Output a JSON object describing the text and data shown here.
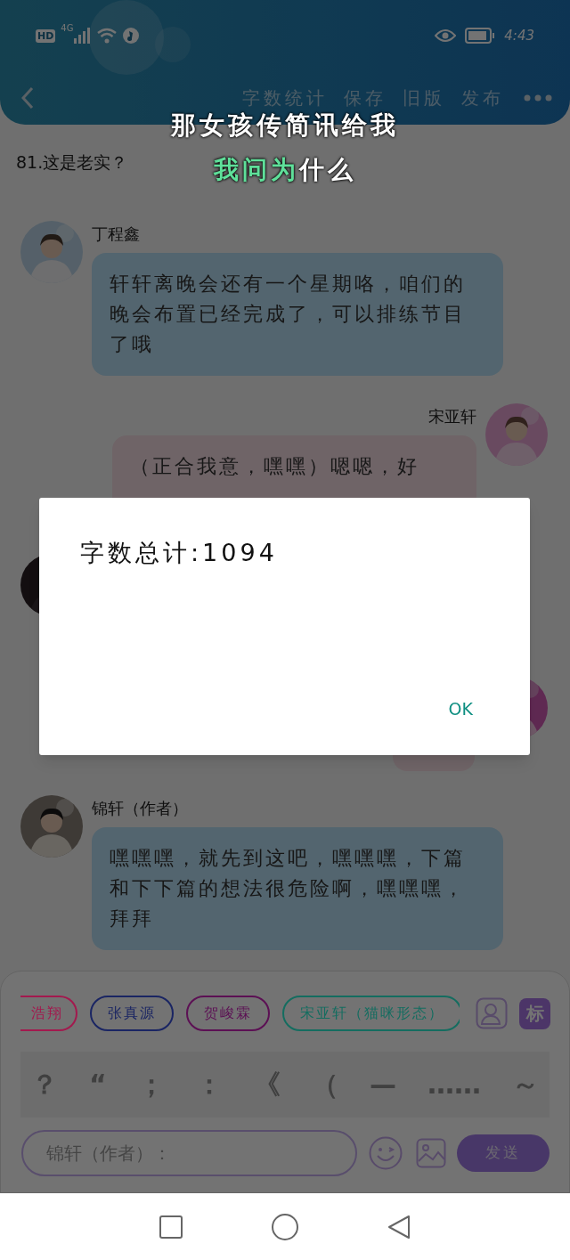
{
  "status_bar": {
    "network_labels": [
      "HD",
      "4G"
    ],
    "time": "4:43"
  },
  "toolbar": {
    "actions": [
      "字数统计",
      "保存",
      "旧版",
      "发布"
    ]
  },
  "captions": [
    {
      "segments": [
        {
          "text": "那女孩传简讯给我",
          "highlighted": false
        }
      ]
    },
    {
      "segments": [
        {
          "text": "我问为",
          "highlighted": true
        },
        {
          "text": "什么",
          "highlighted": false
        }
      ]
    }
  ],
  "chapter_title": "81.这是老实？",
  "messages": [
    {
      "kind": "incoming",
      "name": "丁程鑫",
      "text": "轩轩离晚会还有一个星期咯，咱们的晚会布置已经完成了，可以排练节目了哦"
    },
    {
      "kind": "outgoing",
      "name": "宋亚轩",
      "text": "（正合我意，嘿嘿）嗯嗯，好"
    },
    {
      "kind": "incoming"
    },
    {
      "kind": "outgoing"
    },
    {
      "kind": "incoming",
      "name": "锦轩（作者）",
      "text": "嘿嘿嘿，就先到这吧，嘿嘿嘿，下篇和下下篇的想法很危险啊，嘿嘿嘿，拜拜"
    }
  ],
  "character_chips": [
    {
      "label": "浩翔",
      "color": "#a3194e"
    },
    {
      "label": "张真源",
      "color": "#1a2563"
    },
    {
      "label": "贺峻霖",
      "color": "#5c1054"
    },
    {
      "label": "宋亚轩（猫咪形态）",
      "color": "#146d60"
    }
  ],
  "tag_button": "标",
  "punctuation_keys": [
    "？",
    "“",
    "；",
    "：",
    "《",
    "（",
    "—",
    "……",
    "～"
  ],
  "input": {
    "placeholder": "锦轩（作者）："
  },
  "send_button": "发送",
  "dialog": {
    "message": "字数总计:1094",
    "button": "OK"
  }
}
